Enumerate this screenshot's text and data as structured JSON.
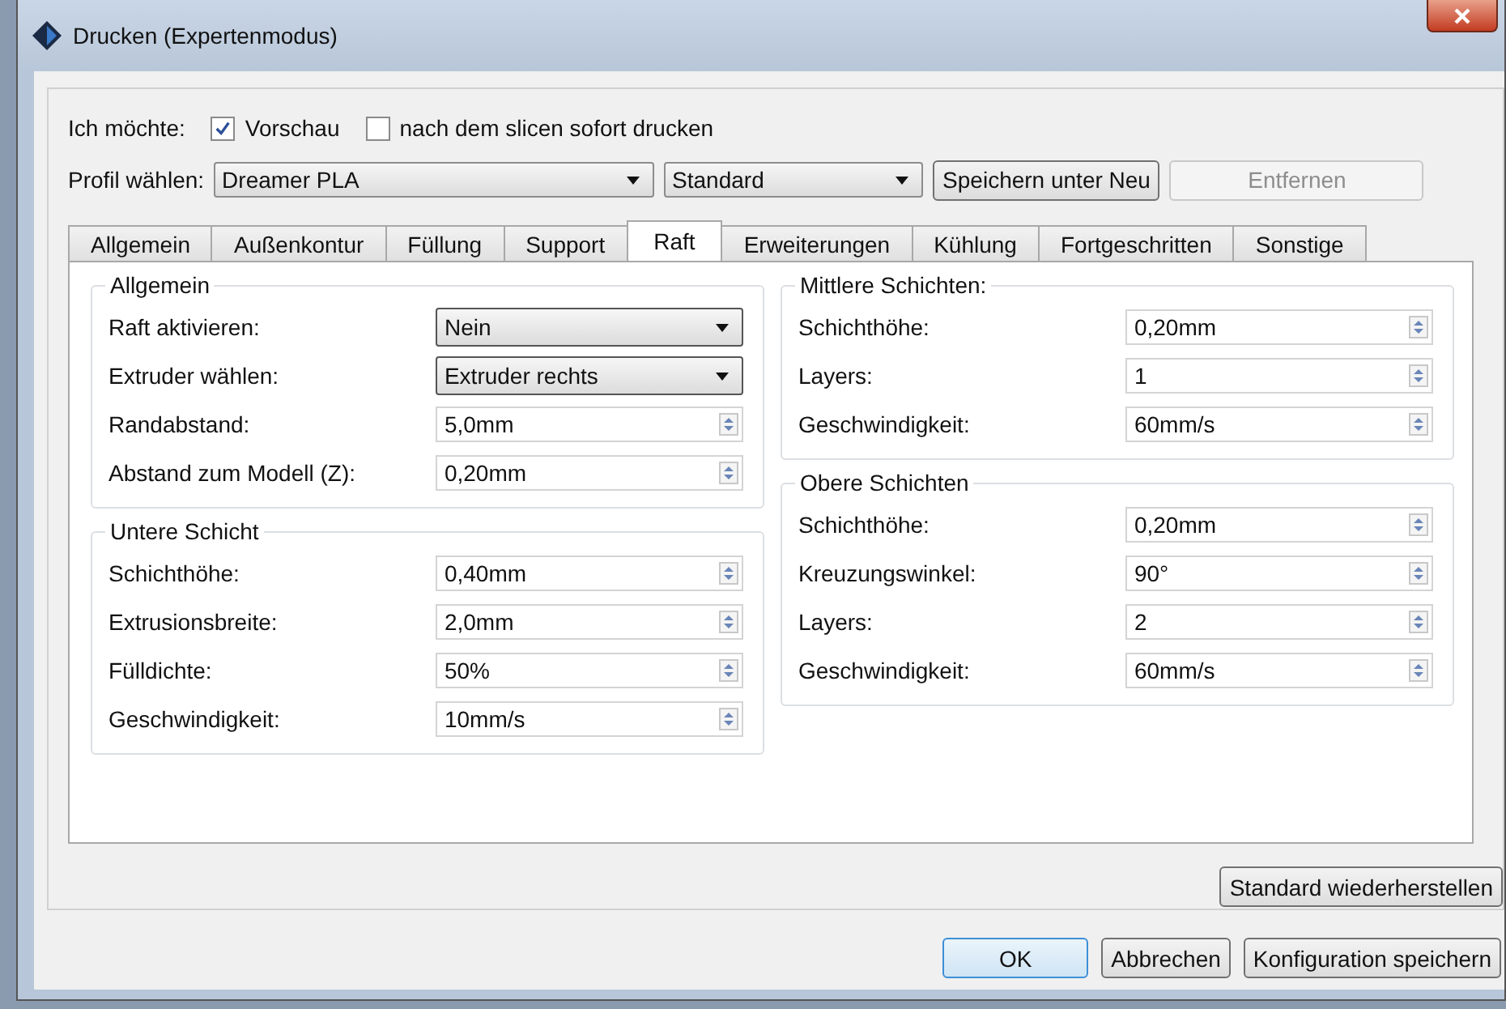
{
  "window": {
    "title": "Drucken (Expertenmodus)"
  },
  "options": {
    "label": "Ich möchte:",
    "checkboxes": [
      {
        "label": "Vorschau",
        "checked": true
      },
      {
        "label": "nach dem slicen sofort drucken",
        "checked": false
      }
    ]
  },
  "profile": {
    "label": "Profil wählen:",
    "profile_select": "Dreamer PLA",
    "preset_select": "Standard",
    "buttons": [
      {
        "label": "Speichern unter Neu",
        "disabled": false
      },
      {
        "label": "Entfernen",
        "disabled": true
      }
    ]
  },
  "tabs": [
    {
      "label": "Allgemein",
      "selected": false
    },
    {
      "label": "Außenkontur",
      "selected": false
    },
    {
      "label": "Füllung",
      "selected": false
    },
    {
      "label": "Support",
      "selected": false
    },
    {
      "label": "Raft",
      "selected": true
    },
    {
      "label": "Erweiterungen",
      "selected": false
    },
    {
      "label": "Kühlung",
      "selected": false
    },
    {
      "label": "Fortgeschritten",
      "selected": false
    },
    {
      "label": "Sonstige",
      "selected": false
    }
  ],
  "columns": [
    [
      {
        "title": "Allgemein",
        "fields": [
          {
            "label": "Raft aktivieren:",
            "kind": "select",
            "value": "Nein"
          },
          {
            "label": "Extruder wählen:",
            "kind": "select",
            "value": "Extruder rechts"
          },
          {
            "label": "Randabstand:",
            "kind": "spin",
            "value": "5,0mm"
          },
          {
            "label": "Abstand zum Modell (Z):",
            "kind": "spin",
            "value": "0,20mm"
          }
        ]
      },
      {
        "title": "Untere Schicht",
        "fields": [
          {
            "label": "Schichthöhe:",
            "kind": "spin",
            "value": "0,40mm"
          },
          {
            "label": "Extrusionsbreite:",
            "kind": "spin",
            "value": "2,0mm"
          },
          {
            "label": "Fülldichte:",
            "kind": "spin",
            "value": "50%"
          },
          {
            "label": "Geschwindigkeit:",
            "kind": "spin",
            "value": "10mm/s"
          }
        ]
      }
    ],
    [
      {
        "title": "Mittlere Schichten:",
        "fields": [
          {
            "label": "Schichthöhe:",
            "kind": "spin",
            "value": "0,20mm"
          },
          {
            "label": "Layers:",
            "kind": "spin",
            "value": "1"
          },
          {
            "label": "Geschwindigkeit:",
            "kind": "spin",
            "value": "60mm/s"
          }
        ]
      },
      {
        "title": "Obere Schichten",
        "fields": [
          {
            "label": "Schichthöhe:",
            "kind": "spin",
            "value": "0,20mm"
          },
          {
            "label": "Kreuzungswinkel:",
            "kind": "spin",
            "value": "90°"
          },
          {
            "label": "Layers:",
            "kind": "spin",
            "value": "2"
          },
          {
            "label": "Geschwindigkeit:",
            "kind": "spin",
            "value": "60mm/s"
          }
        ]
      }
    ]
  ],
  "restore_button": "Standard wiederherstellen",
  "buttons": [
    {
      "label": "OK",
      "default": true
    },
    {
      "label": "Abbrechen",
      "default": false
    },
    {
      "label": "Konfiguration speichern",
      "default": false
    }
  ]
}
